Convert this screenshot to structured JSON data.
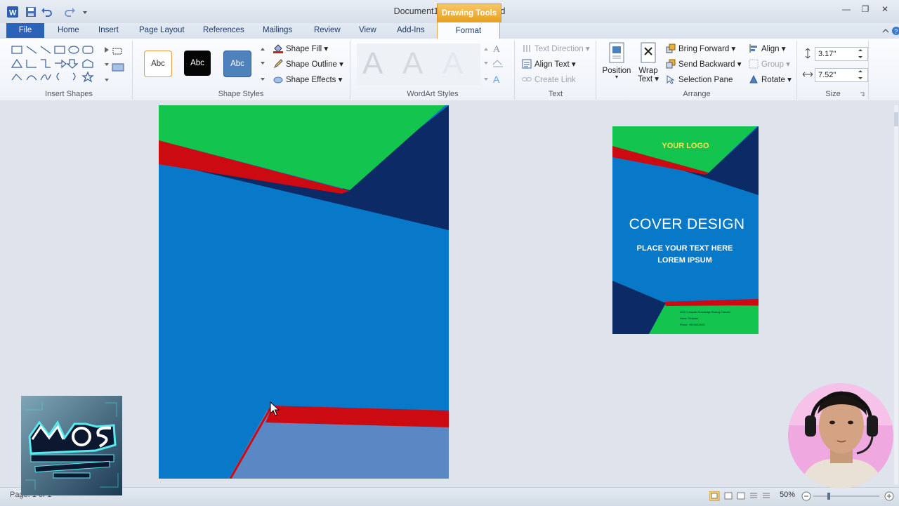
{
  "titlebar": {
    "title": "Document1 - Microsoft Word",
    "context_label": "Drawing Tools"
  },
  "tabs": {
    "file": "File",
    "home": "Home",
    "insert": "Insert",
    "page_layout": "Page Layout",
    "references": "References",
    "mailings": "Mailings",
    "review": "Review",
    "view": "View",
    "add_ins": "Add-Ins",
    "format": "Format"
  },
  "ribbon": {
    "insert_shapes": {
      "label": "Insert Shapes"
    },
    "shape_styles": {
      "label": "Shape Styles",
      "swatch1": "Abc",
      "swatch2": "Abc",
      "swatch3": "Abc",
      "shape_fill": "Shape Fill",
      "shape_outline": "Shape Outline",
      "shape_effects": "Shape Effects"
    },
    "wordart_styles": {
      "label": "WordArt Styles",
      "letter": "A"
    },
    "text": {
      "label": "Text",
      "text_direction": "Text Direction",
      "align_text": "Align Text",
      "create_link": "Create Link"
    },
    "arrange": {
      "label": "Arrange",
      "position": "Position",
      "wrap_text_1": "Wrap",
      "wrap_text_2": "Text",
      "bring_forward": "Bring Forward",
      "send_backward": "Send Backward",
      "selection_pane": "Selection Pane",
      "align": "Align",
      "group": "Group",
      "rotate": "Rotate"
    },
    "size": {
      "label": "Size",
      "height": "3.17\"",
      "width": "7.52\""
    }
  },
  "thumbnail": {
    "logo": "YOUR LOGO",
    "title": "COVER DESIGN",
    "subtitle_1": "PLACE YOUR TEXT HERE",
    "subtitle_2": "LOREM IPSUM",
    "small_1": "MOS Computer Knowledge Sharing Channel",
    "small_2": "Name: Template",
    "small_3": "Phone: +85 00000000"
  },
  "statusbar": {
    "page_info": "Page: 1 of 1",
    "zoom": "50%"
  },
  "colors": {
    "green": "#13c44e",
    "red": "#cc0a12",
    "navy": "#0b2a66",
    "blue": "#0878c8",
    "light_blue": "#5a88c4",
    "file_tab": "#2a63b8"
  }
}
